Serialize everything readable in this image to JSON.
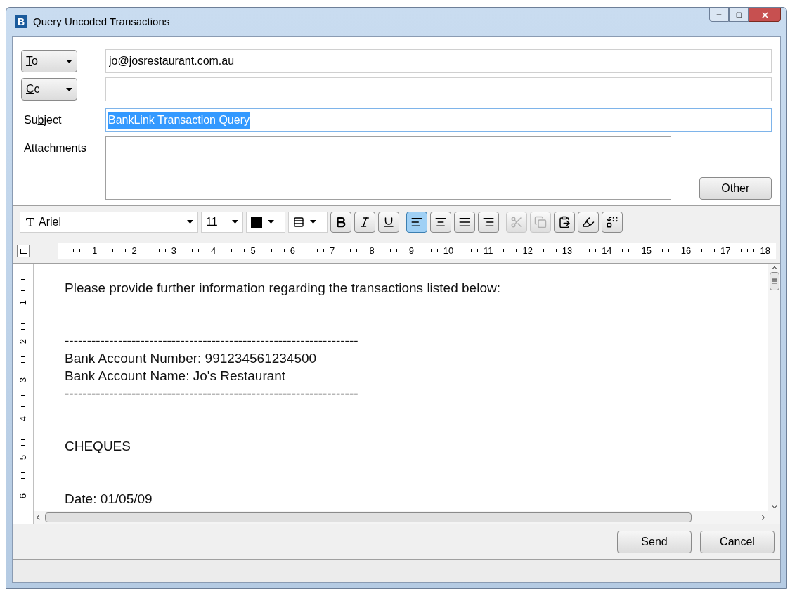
{
  "window": {
    "title": "Query Uncoded Transactions",
    "app_icon": "B"
  },
  "recipients": [
    {
      "access_key": "T",
      "label_after": "o",
      "value": "jo@josrestaurant.com.au"
    },
    {
      "access_key": "C",
      "label_after": "c"
    }
  ],
  "subject": {
    "label_before": "Su",
    "access_key": "b",
    "label_after": "ject",
    "value": "BankLink Transaction Query",
    "selected": true
  },
  "attachments": {
    "label": "Attachments",
    "button": "Other"
  },
  "toolbar": {
    "font": "Ariel",
    "size": "11",
    "buttons": [
      {
        "kind": "bold",
        "selected": false,
        "disabled": false
      },
      {
        "kind": "italic",
        "selected": false,
        "disabled": false
      },
      {
        "kind": "underline",
        "selected": false,
        "disabled": false
      },
      {
        "kind": "align-left",
        "selected": true,
        "disabled": false
      },
      {
        "kind": "align-center",
        "selected": false,
        "disabled": false
      },
      {
        "kind": "justify",
        "selected": false,
        "disabled": false
      },
      {
        "kind": "align-right",
        "selected": false,
        "disabled": false
      },
      {
        "kind": "cut",
        "selected": false,
        "disabled": true
      },
      {
        "kind": "copy",
        "selected": false,
        "disabled": true
      },
      {
        "kind": "paste",
        "selected": false,
        "disabled": false
      },
      {
        "kind": "highlight",
        "selected": false,
        "disabled": false
      },
      {
        "kind": "replace",
        "selected": false,
        "disabled": false
      }
    ]
  },
  "ruler": {
    "marks": [
      "1",
      "2",
      "3",
      "4",
      "5",
      "6",
      "7",
      "8",
      "9",
      "10",
      "11",
      "12",
      "13",
      "14",
      "15",
      "16",
      "17",
      "18"
    ],
    "vertical_marks": [
      "1",
      "2",
      "3",
      "4",
      "5",
      "6"
    ]
  },
  "body": [
    {
      "kind": "text",
      "text": "Please provide further information regarding the transactions listed below:"
    },
    {
      "kind": "spacer"
    },
    {
      "kind": "spacer"
    },
    {
      "kind": "text",
      "text": "------------------------------------------------------------------"
    },
    {
      "kind": "text",
      "text": "Bank Account Number: 991234561234500"
    },
    {
      "kind": "text",
      "text": "Bank Account Name: Jo's Restaurant"
    },
    {
      "kind": "text",
      "text": "------------------------------------------------------------------"
    },
    {
      "kind": "spacer"
    },
    {
      "kind": "spacer"
    },
    {
      "kind": "text",
      "text": "CHEQUES"
    },
    {
      "kind": "spacer"
    },
    {
      "kind": "spacer"
    },
    {
      "kind": "text",
      "text": "Date: 01/05/09"
    }
  ],
  "buttons": [
    {
      "label": "Send"
    },
    {
      "label": "Cancel"
    }
  ]
}
